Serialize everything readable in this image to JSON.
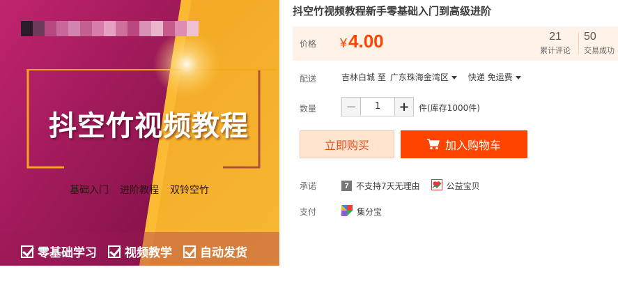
{
  "promo": {
    "title": "抖空竹视频教程",
    "tags": [
      "基础入门",
      "进阶教程",
      "双铃空竹"
    ],
    "features": [
      "零基础学习",
      "视频教学",
      "自动发货"
    ],
    "mosaic_colors": [
      "#2a1b2a",
      "#6e3a5c",
      "#b5487e",
      "#c9679a",
      "#d184ad",
      "#c2608f",
      "#d87da9",
      "#e6a0c2",
      "#cf6d9b",
      "#b7477c",
      "#d891b4",
      "#e8b5cc",
      "#c55a8b",
      "#dd8cb2",
      "#f0c0d6"
    ]
  },
  "product": {
    "title": "抖空竹视频教程新手零基础入门到高级进阶"
  },
  "price": {
    "label": "价格",
    "currency": "¥",
    "value": "4.00",
    "reviews_count": "21",
    "reviews_label": "累计评论",
    "sales_count": "50",
    "sales_label": "交易成功"
  },
  "shipping": {
    "label": "配送",
    "from": "吉林白城 至",
    "to": "广东珠海金湾区",
    "method": "快递 免运费"
  },
  "quantity": {
    "label": "数量",
    "value": "1",
    "decrement": "−",
    "increment": "+",
    "stock": "件(库存1000件)"
  },
  "actions": {
    "buy_now": "立即购买",
    "add_cart": "加入购物车"
  },
  "promise": {
    "label": "承诺",
    "items": [
      {
        "icon": "seven-day-icon",
        "glyph": "7",
        "text": "不支持7天无理由"
      },
      {
        "icon": "charity-icon",
        "text": "公益宝贝"
      }
    ]
  },
  "payment": {
    "label": "支付",
    "item": "集分宝",
    "icon": "jifenbao-icon"
  },
  "colors": {
    "accent": "#ff4400",
    "price_bg": "#fff2e8",
    "buy_now_bg": "#ffe4d0",
    "promo_magenta": "#b01f64",
    "promo_orange": "#f6a418"
  }
}
